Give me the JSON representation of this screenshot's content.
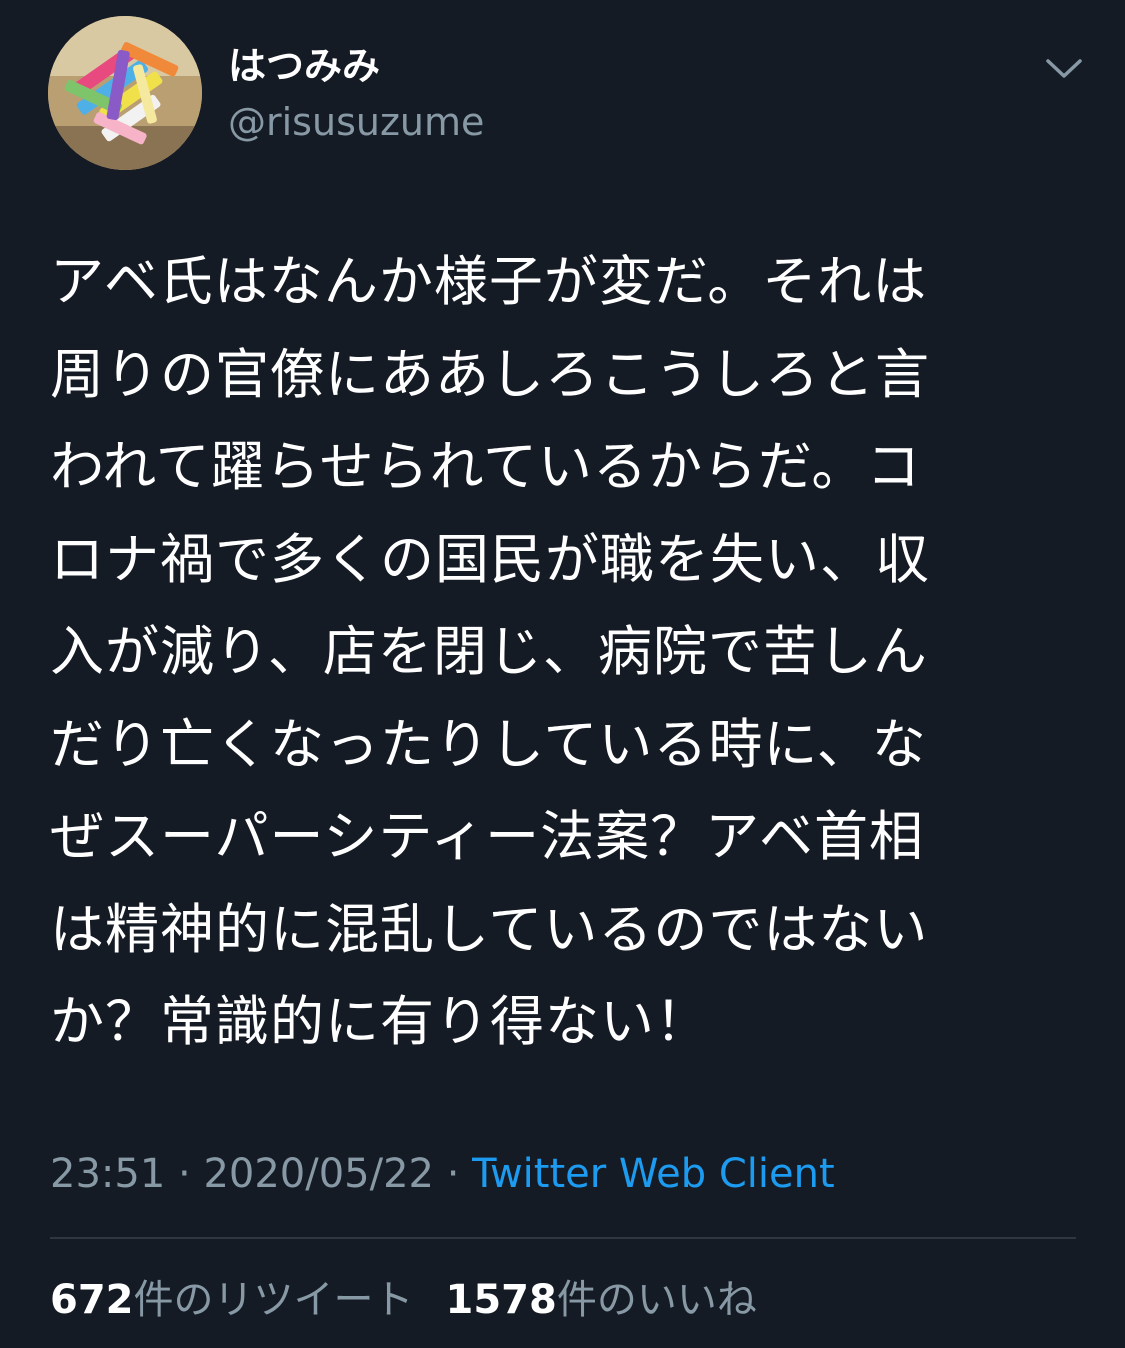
{
  "user": {
    "display_name": "はつみみ",
    "handle": "@risusuzume",
    "avatar_icon": "avatar-chalk-photo"
  },
  "menu": {
    "icon": "chevron-down-icon"
  },
  "tweet": {
    "lines": [
      "アベ氏はなんか様子が変だ。それは",
      "周りの官僚にああしろこうしろと言",
      "われて躍らせられているからだ。コ",
      "ロナ禍で多くの国民が職を失い、収",
      "入が減り、店を閉じ、病院で苦しん",
      "だり亡くなったりしている時に、な",
      "ぜスーパーシティー法案？アベ首相",
      "は精神的に混乱しているのではない",
      "か？常識的に有り得ない！"
    ]
  },
  "meta": {
    "time": "23:51",
    "separator1": " · ",
    "date": "2020/05/22",
    "separator2": " · ",
    "source": "Twitter Web Client"
  },
  "stats": {
    "retweets_count": "672",
    "retweets_label": "件のリツイート",
    "likes_count": "1578",
    "likes_label": "件のいいね"
  },
  "colors": {
    "background": "#151b24",
    "text": "#ffffff",
    "secondary": "#8899a6",
    "link": "#1d9bf0"
  }
}
